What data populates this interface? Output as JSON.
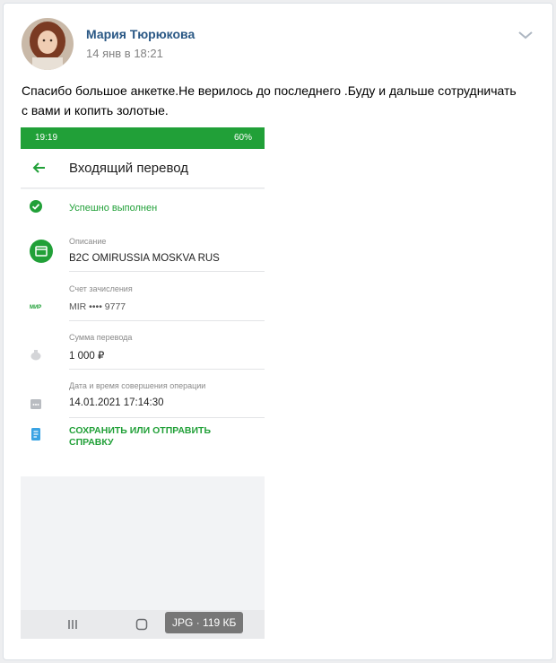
{
  "post": {
    "author": "Мария Тюрюкова",
    "date": "14 янв в 18:21",
    "text": "Спасибо большое анкетке.Не верилось до последнего .Буду и дальше сотрудничать с вами и копить золотые."
  },
  "attachment": {
    "file_type": "JPG",
    "separator": "·",
    "file_size": "119 КБ",
    "screenshot": {
      "status_time": "19:19",
      "battery": "60%",
      "title": "Входящий перевод",
      "status": "Успешно выполнен",
      "description_label": "Описание",
      "description_value": "B2C OMIRUSSIA MOSKVA RUS",
      "account_label": "Счет зачисления",
      "account_value": "MIR •••• 9777",
      "mir_logo": "МИР",
      "amount_label": "Сумма перевода",
      "amount_value": "1 000 ₽",
      "datetime_label": "Дата и время совершения операции",
      "datetime_value": "14.01.2021 17:14:30",
      "action": "СОХРАНИТЬ ИЛИ ОТПРАВИТЬ СПРАВКУ"
    }
  },
  "colors": {
    "link": "#2a5885",
    "sber_green": "#21a038",
    "muted": "#828282"
  }
}
